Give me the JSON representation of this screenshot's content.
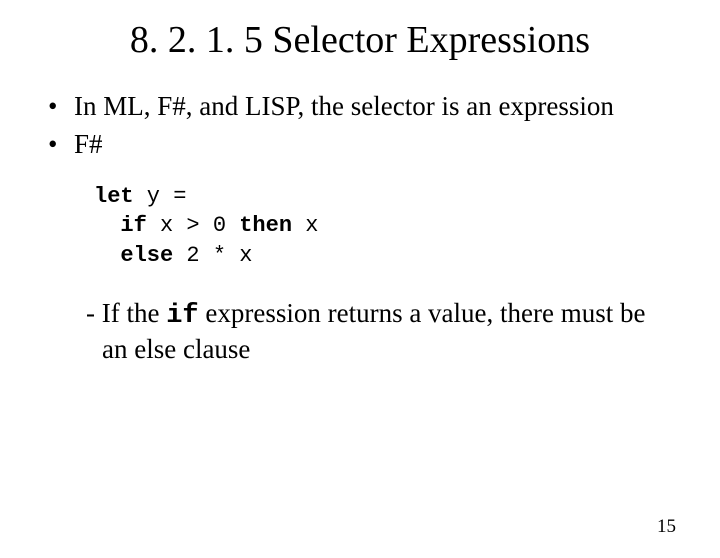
{
  "title": "8. 2. 1. 5 Selector Expressions",
  "bullets": [
    "In ML, F#, and LISP, the selector is an expression",
    "F#"
  ],
  "code": {
    "line1_kw": "let",
    "line1_rest": " y =",
    "line2_kw": "if",
    "line2_mid": " x > 0 ",
    "line2_kw2": "then",
    "line2_rest": " x",
    "line3_kw": "else",
    "line3_rest": " 2 * x"
  },
  "note": {
    "pre": "- If the ",
    "if_kw": "if",
    "post": " expression returns a value, there must be an else clause"
  },
  "page_number": "15"
}
